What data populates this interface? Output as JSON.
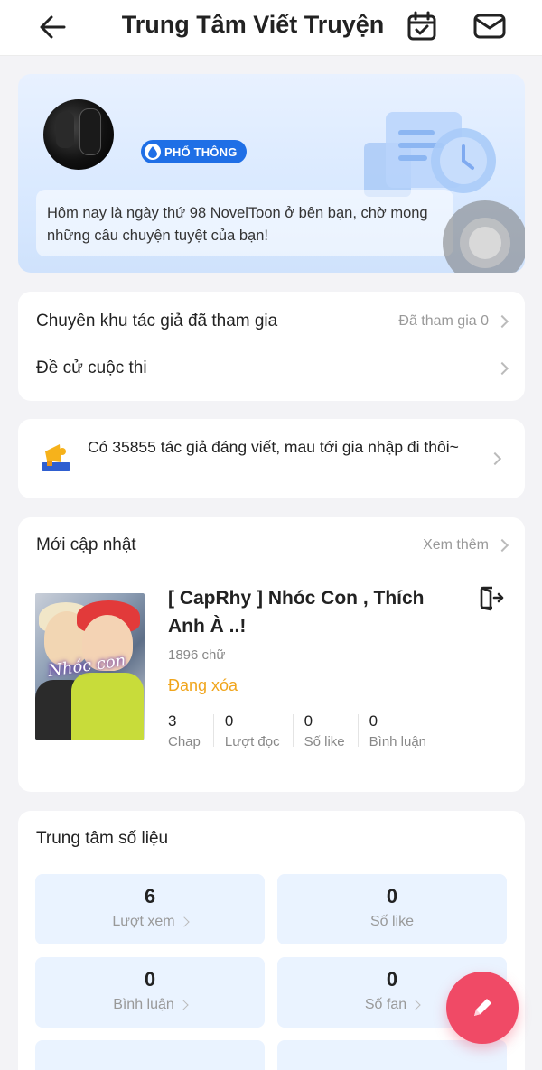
{
  "header": {
    "title": "Trung Tâm Viết Truyện",
    "icons": [
      "back-arrow-icon",
      "calendar-check-icon",
      "mail-icon"
    ]
  },
  "profile": {
    "badge": "PHỔ THÔNG",
    "message": "Hôm nay là ngày thứ 98 NovelToon ở bên bạn, chờ mong những câu chuyện tuyệt của bạn!"
  },
  "links": {
    "zones_label": "Chuyên khu tác giả đã tham gia",
    "zones_value": "Đã tham gia 0",
    "contest_label": "Đề cử cuộc thi"
  },
  "promo": {
    "text": "Có 35855 tác giả đáng viết, mau tới gia nhập đi thôi~"
  },
  "updates": {
    "section_title": "Mới cập nhật",
    "see_more": "Xem thêm",
    "story": {
      "title": "[ CapRhy ] Nhóc Con , Thích Anh À ..!",
      "cover_text": "Nhóc con",
      "words": "1896 chữ",
      "status": "Đang xóa",
      "stats": [
        {
          "value": "3",
          "label": "Chap"
        },
        {
          "value": "0",
          "label": "Lượt đọc"
        },
        {
          "value": "0",
          "label": "Số like"
        },
        {
          "value": "0",
          "label": "Bình luận"
        }
      ]
    }
  },
  "data_center": {
    "section_title": "Trung tâm số liệu",
    "tiles": [
      {
        "value": "6",
        "label": "Lượt xem"
      },
      {
        "value": "0",
        "label": "Số like"
      },
      {
        "value": "0",
        "label": "Bình luận"
      },
      {
        "value": "0",
        "label": "Số fan"
      }
    ]
  },
  "colors": {
    "accent_blue": "#1f6fe6",
    "status_orange": "#f0a51c",
    "fab_red": "#f04a66"
  }
}
